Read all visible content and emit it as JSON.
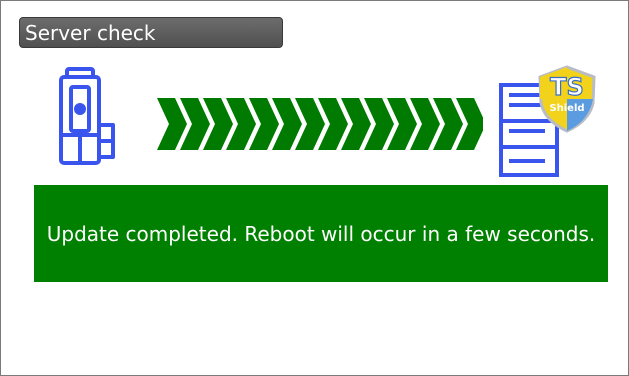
{
  "title": "Server check",
  "message": "Update completed. Reboot will occur in a few seconds.",
  "badge": {
    "line1": "TS",
    "line2": "Shield"
  },
  "icons": {
    "instrument": "total-station-icon",
    "transfer": "transfer-arrows",
    "server": "server-icon",
    "badge": "ts-shield-badge"
  },
  "colors": {
    "accent": "#008000",
    "icon_blue": "#3a55ee",
    "title_bar": "#5a5a5a",
    "badge_yellow": "#f2d21b",
    "badge_blue": "#5b9be0"
  }
}
